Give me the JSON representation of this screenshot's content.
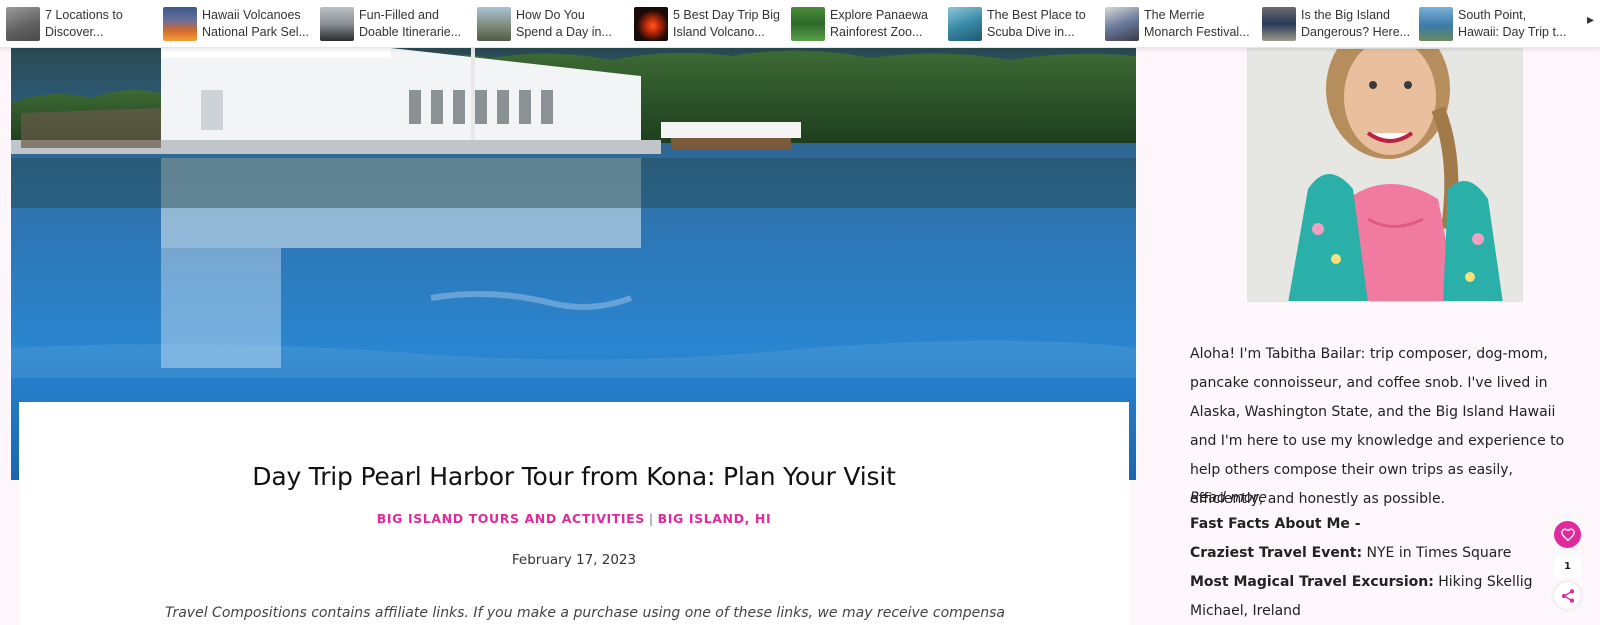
{
  "carousel": {
    "items": [
      {
        "line1": "7 Locations to",
        "line2": "Discover...",
        "thumb": "mountain-landscape-thumb"
      },
      {
        "line1": "Hawaii Volcanoes",
        "line2": "National Park Sel...",
        "thumb": "lava-sunset-thumb"
      },
      {
        "line1": "Fun-Filled and",
        "line2": "Doable Itinerarie...",
        "thumb": "black-sand-beach-thumb"
      },
      {
        "line1": "How Do You",
        "line2": "Spend a Day in...",
        "thumb": "rocky-coast-thumb"
      },
      {
        "line1": "5 Best Day Trip Big",
        "line2": "Island Volcano...",
        "thumb": "lava-glow-thumb"
      },
      {
        "line1": "Explore Panaewa",
        "line2": "Rainforest Zoo...",
        "thumb": "zoo-sign-thumb"
      },
      {
        "line1": "The Best Place to",
        "line2": "Scuba Dive in...",
        "thumb": "underwater-thumb"
      },
      {
        "line1": "The Merrie",
        "line2": "Monarch Festival...",
        "thumb": "festival-crowd-thumb"
      },
      {
        "line1": "Is the Big Island",
        "line2": "Dangerous? Here...",
        "thumb": "road-sign-thumb"
      },
      {
        "line1": "South Point,",
        "line2": "Hawaii: Day Trip t...",
        "thumb": "ocean-cliff-thumb"
      }
    ],
    "next_icon": "chevron-right-icon"
  },
  "article": {
    "title": "Day Trip Pearl Harbor Tour from Kona: Plan Your Visit",
    "categories": [
      "BIG ISLAND TOURS AND ACTIVITIES",
      "BIG ISLAND, HI"
    ],
    "separator": "|",
    "date": "February 17, 2023",
    "disclaimer": "Travel Compositions contains affiliate links. If you make a purchase using one of these links, we may receive compensation at"
  },
  "sidebar": {
    "bio": "Aloha! I'm Tabitha Bailar: trip composer, dog-mom, pancake connoisseur, and coffee snob. I've lived in Alaska, Washington State, and the Big Island Hawaii and I'm here to use my knowledge and experience to help others compose their own trips as easily, efficiently, and honestly as possible.",
    "read_more": "Read more",
    "fast_facts_heading": "Fast Facts About Me -",
    "facts": [
      {
        "label": "Craziest Travel Event:",
        "value": " NYE in Times Square"
      },
      {
        "label": "Most Magical Travel Excursion:",
        "value": " Hiking Skellig Michael, Ireland"
      }
    ]
  },
  "share": {
    "count": "1",
    "heart_icon": "heart-icon",
    "share_icon": "share-icon"
  },
  "colors": {
    "accent": "#e0299c",
    "page_bg": "#fdf6fb"
  }
}
